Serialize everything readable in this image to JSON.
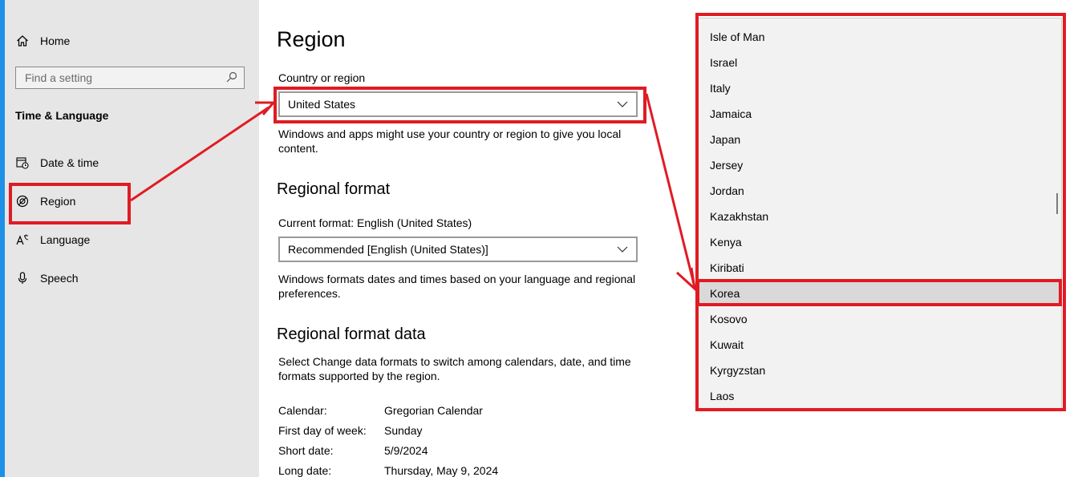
{
  "sidebar": {
    "home_label": "Home",
    "search_placeholder": "Find a setting",
    "section_title": "Time & Language",
    "items": [
      {
        "label": "Date & time",
        "icon": "calendar-clock-icon"
      },
      {
        "label": "Region",
        "icon": "globe-icon"
      },
      {
        "label": "Language",
        "icon": "language-icon"
      },
      {
        "label": "Speech",
        "icon": "microphone-icon"
      }
    ]
  },
  "main": {
    "title": "Region",
    "country_label": "Country or region",
    "country_value": "United States",
    "country_desc": "Windows and apps might use your country or region to give you local content.",
    "regional_format_title": "Regional format",
    "current_format_label": "Current format: English (United States)",
    "format_value": "Recommended [English (United States)]",
    "format_desc": "Windows formats dates and times based on your language and regional preferences.",
    "format_data_title": "Regional format data",
    "format_data_desc": "Select Change data formats to switch among calendars, date, and time formats supported by the region.",
    "data_rows": [
      {
        "key": "Calendar:",
        "value": "Gregorian Calendar"
      },
      {
        "key": "First day of week:",
        "value": "Sunday"
      },
      {
        "key": "Short date:",
        "value": "5/9/2024"
      },
      {
        "key": "Long date:",
        "value": "Thursday, May 9, 2024"
      }
    ]
  },
  "dropdown": {
    "items": [
      "Isle of Man",
      "Israel",
      "Italy",
      "Jamaica",
      "Japan",
      "Jersey",
      "Jordan",
      "Kazakhstan",
      "Kenya",
      "Kiribati",
      "Korea",
      "Kosovo",
      "Kuwait",
      "Kyrgyzstan",
      "Laos"
    ],
    "selected": "Korea"
  },
  "colors": {
    "highlight": "#e01b24",
    "sidebar_bg": "#e6e6e6",
    "dropdown_bg": "#f2f2f2",
    "accent": "#1e90e8"
  }
}
